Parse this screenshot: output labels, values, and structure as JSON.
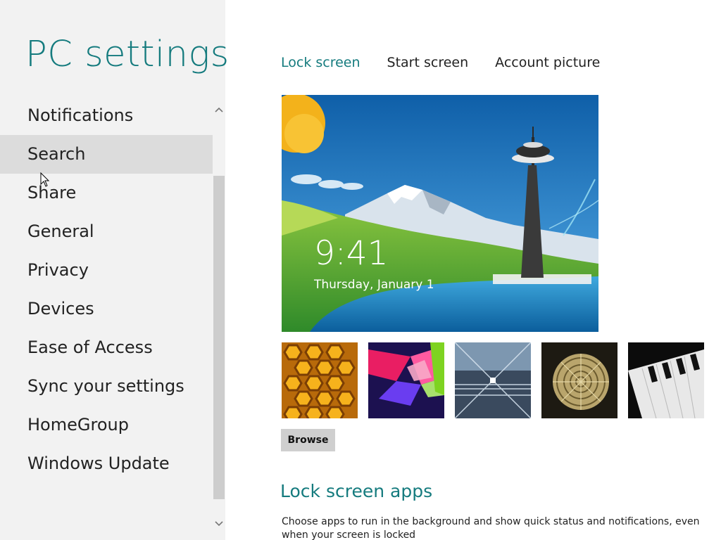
{
  "title": "PC settings",
  "nav": {
    "items": [
      {
        "label": "Notifications"
      },
      {
        "label": "Search"
      },
      {
        "label": "Share"
      },
      {
        "label": "General"
      },
      {
        "label": "Privacy"
      },
      {
        "label": "Devices"
      },
      {
        "label": "Ease of Access"
      },
      {
        "label": "Sync your settings"
      },
      {
        "label": "HomeGroup"
      },
      {
        "label": "Windows Update"
      }
    ],
    "selected": "Search"
  },
  "tabs": [
    {
      "label": "Lock screen",
      "active": true
    },
    {
      "label": "Start screen",
      "active": false
    },
    {
      "label": "Account picture",
      "active": false
    }
  ],
  "preview": {
    "time": "9:41",
    "date": "Thursday, January 1"
  },
  "thumbnails": [
    {
      "name": "honeycomb"
    },
    {
      "name": "colorful-shapes"
    },
    {
      "name": "tunnel"
    },
    {
      "name": "nautilus-shell"
    },
    {
      "name": "piano-keys"
    }
  ],
  "browse_label": "Browse",
  "lock_screen_apps": {
    "title": "Lock screen apps",
    "description": "Choose apps to run in the background and show quick status and notifications, even when your screen is locked"
  },
  "colors": {
    "accent": "#157b7e",
    "left_pane_bg": "#f2f2f2",
    "selected_item_bg": "#dcdcdc"
  }
}
